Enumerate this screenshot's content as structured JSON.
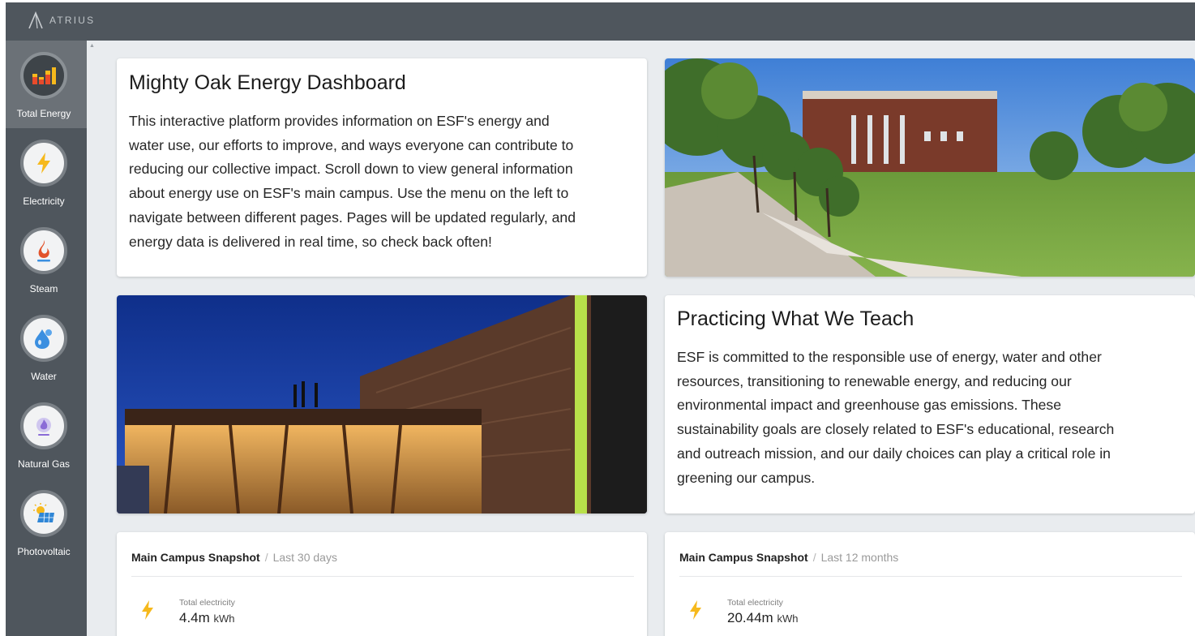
{
  "brand": {
    "name": "ATRIUS"
  },
  "sidebar": {
    "items": [
      {
        "label": "Total Energy",
        "icon": "bar-chart-icon",
        "active": true
      },
      {
        "label": "Electricity",
        "icon": "lightning-bolt-icon",
        "active": false
      },
      {
        "label": "Steam",
        "icon": "flame-icon",
        "active": false
      },
      {
        "label": "Water",
        "icon": "water-drop-icon",
        "active": false
      },
      {
        "label": "Natural Gas",
        "icon": "gas-flame-icon",
        "active": false
      },
      {
        "label": "Photovoltaic",
        "icon": "solar-panel-icon",
        "active": false
      }
    ]
  },
  "intro": {
    "title": "Mighty Oak Energy Dashboard",
    "lines": [
      "This interactive platform provides information on ESF's energy and",
      "water use, our efforts to improve, and ways everyone can contribute to",
      "reducing our collective impact. Scroll down to view general information",
      "about energy use on ESF's main campus. Use the menu on the left to",
      "navigate between different pages. Pages will be updated regularly, and",
      "energy data is delivered in real time, so check back often!"
    ]
  },
  "practice": {
    "title": "Practicing What We Teach",
    "lines": [
      "ESF is committed to the responsible use of energy, water and other",
      "resources, transitioning to renewable energy, and reducing our",
      "environmental impact and greenhouse gas emissions. These",
      "sustainability goals are closely related to ESF's educational, research",
      "and outreach mission, and our daily choices can play a critical role in",
      "greening our campus."
    ]
  },
  "snapshots": [
    {
      "title": "Main Campus Snapshot",
      "separator": "/",
      "range": "Last 30 days",
      "metric_label": "Total electricity",
      "metric_value": "4.4m",
      "metric_unit": "kWh"
    },
    {
      "title": "Main Campus Snapshot",
      "separator": "/",
      "range": "Last 12 months",
      "metric_label": "Total electricity",
      "metric_value": "20.44m",
      "metric_unit": "kWh"
    }
  ],
  "colors": {
    "topbar": "#4f565d",
    "sidebar": "#4f565d",
    "sidebar_active": "#6b7177",
    "background": "#e9ecef",
    "electric_accent": "#f6b91c",
    "steam_accent": "#e2532b",
    "water_accent": "#3b8fe0",
    "gas_accent": "#8a6bd6"
  }
}
